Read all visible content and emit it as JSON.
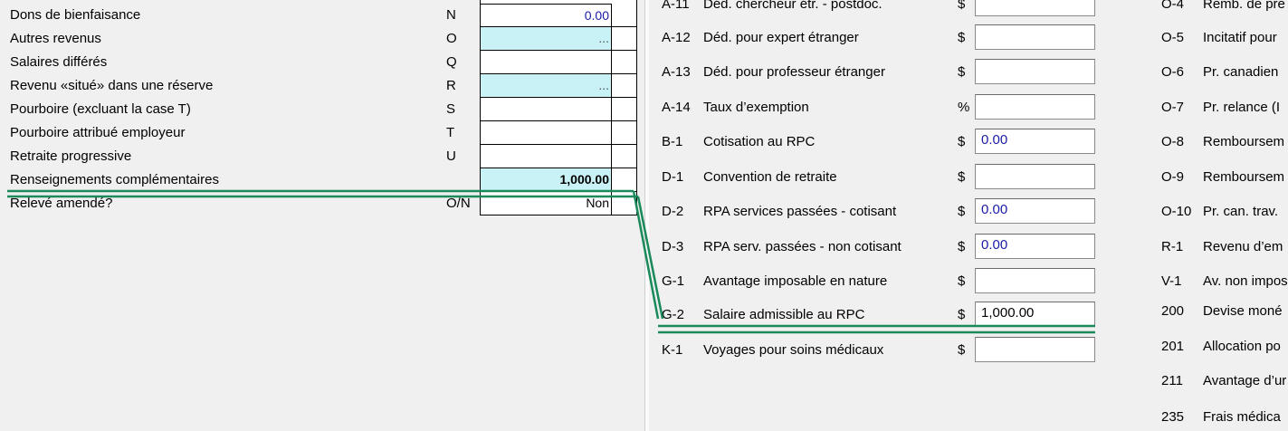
{
  "left_rows": [
    {
      "label": "Dons de bienfaisance",
      "code": "N",
      "value": "0.00",
      "style": "white"
    },
    {
      "label": "Autres revenus",
      "code": "O",
      "value": "...",
      "style": "cyan"
    },
    {
      "label": "Salaires différés",
      "code": "Q",
      "value": "",
      "style": "white"
    },
    {
      "label": "Revenu «situé» dans une réserve",
      "code": "R",
      "value": "...",
      "style": "cyan"
    },
    {
      "label": "Pourboire (excluant la case T)",
      "code": "S",
      "value": "",
      "style": "white"
    },
    {
      "label": "Pourboire attribué employeur",
      "code": "T",
      "value": "",
      "style": "white"
    },
    {
      "label": "Retraite progressive",
      "code": "U",
      "value": "",
      "style": "white"
    },
    {
      "label": "Renseignements complémentaires",
      "code": "",
      "value": "1,000.00",
      "style": "cyan-bold"
    },
    {
      "label": "Relevé amendé?",
      "code": "O/N",
      "value": "Non",
      "style": "white-black"
    }
  ],
  "right_rows": [
    {
      "code": "A-11",
      "label": "Déd. chercheur étr. - postdoc.",
      "unit": "$",
      "value": ""
    },
    {
      "code": "A-12",
      "label": "Déd. pour expert étranger",
      "unit": "$",
      "value": ""
    },
    {
      "code": "A-13",
      "label": "Déd. pour professeur étranger",
      "unit": "$",
      "value": ""
    },
    {
      "code": "A-14",
      "label": "Taux d’exemption",
      "unit": "%",
      "value": ""
    },
    {
      "code": "B-1",
      "label": "Cotisation au RPC",
      "unit": "$",
      "value": "0.00"
    },
    {
      "code": "D-1",
      "label": "Convention de retraite",
      "unit": "$",
      "value": ""
    },
    {
      "code": "D-2",
      "label": "RPA services passées - cotisant",
      "unit": "$",
      "value": "0.00"
    },
    {
      "code": "D-3",
      "label": "RPA serv. passées - non cotisant",
      "unit": "$",
      "value": "0.00"
    },
    {
      "code": "G-1",
      "label": "Avantage imposable en nature",
      "unit": "$",
      "value": ""
    },
    {
      "code": "G-2",
      "label": "Salaire admissible au RPC",
      "unit": "$",
      "value": "1,000.00"
    },
    {
      "code": "K-1",
      "label": "Voyages pour soins médicaux",
      "unit": "$",
      "value": ""
    }
  ],
  "far_right_rows": [
    {
      "code": "O-4",
      "label": "Remb. de pre"
    },
    {
      "code": "O-5",
      "label": "Incitatif pour"
    },
    {
      "code": "O-6",
      "label": "Pr. canadien"
    },
    {
      "code": "O-7",
      "label": "Pr. relance (I"
    },
    {
      "code": "O-8",
      "label": "Remboursem"
    },
    {
      "code": "O-9",
      "label": "Remboursem"
    },
    {
      "code": "O-10",
      "label": "Pr. can. trav."
    },
    {
      "code": "R-1",
      "label": "Revenu d’em"
    },
    {
      "code": "V-1",
      "label": "Av. non impos"
    },
    {
      "code": "200",
      "label": "Devise moné"
    },
    {
      "code": "201",
      "label": "Allocation po"
    },
    {
      "code": "211",
      "label": "Avantage d’ur"
    },
    {
      "code": "235",
      "label": "Frais médica"
    }
  ],
  "colors": {
    "field_cyan": "#c8f2f6",
    "value_blue": "#1a1aa8",
    "annotation_green": "#1a8a5a"
  }
}
